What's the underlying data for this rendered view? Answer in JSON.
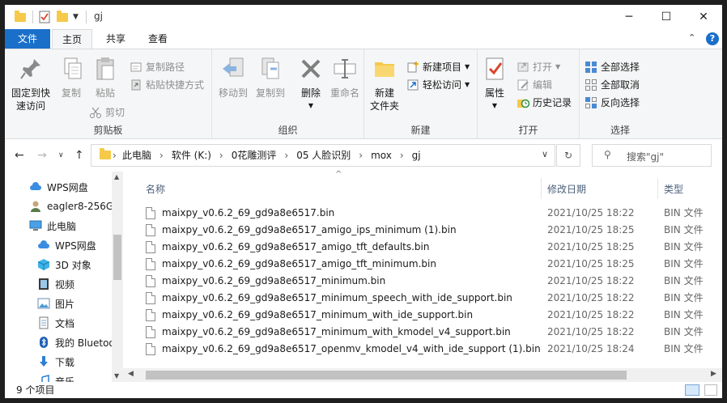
{
  "window": {
    "title": "gj",
    "minimize_glyph": "─",
    "maximize_glyph": "☐",
    "close_glyph": "✕"
  },
  "ribbon_tabs": [
    "文件",
    "主页",
    "共享",
    "查看"
  ],
  "ribbon": {
    "clipboard": {
      "pin": "固定到快\n速访问",
      "copy": "复制",
      "paste": "粘贴",
      "copy_path": "复制路径",
      "paste_shortcut": "粘贴快捷方式",
      "cut": "剪切",
      "label": "剪贴板"
    },
    "organize": {
      "move_to": "移动到",
      "copy_to": "复制到",
      "delete": "删除",
      "rename": "重命名",
      "label": "组织"
    },
    "new": {
      "new_folder": "新建\n文件夹",
      "new_item": "新建项目",
      "easy_access": "轻松访问",
      "label": "新建"
    },
    "open": {
      "properties": "属性",
      "open": "打开",
      "edit": "编辑",
      "history": "历史记录",
      "label": "打开"
    },
    "select": {
      "select_all": "全部选择",
      "select_none": "全部取消",
      "invert": "反向选择",
      "label": "选择"
    }
  },
  "address": {
    "crumbs": [
      "此电脑",
      "软件 (K:)",
      "0花雕测评",
      "05 人脸识别",
      "mox",
      "gj"
    ],
    "search_placeholder": "搜索\"gj\""
  },
  "nav_pane": [
    {
      "label": "WPS网盘",
      "icon": "cloud-icon",
      "indent": 1
    },
    {
      "label": "eagler8-256G",
      "icon": "user-icon",
      "indent": 1
    },
    {
      "label": "此电脑",
      "icon": "computer-icon",
      "indent": 0
    },
    {
      "label": "WPS网盘",
      "icon": "cloud-icon",
      "indent": 2
    },
    {
      "label": "3D 对象",
      "icon": "cube-icon",
      "indent": 2
    },
    {
      "label": "视频",
      "icon": "video-icon",
      "indent": 2
    },
    {
      "label": "图片",
      "icon": "picture-icon",
      "indent": 2
    },
    {
      "label": "文档",
      "icon": "document-icon",
      "indent": 2
    },
    {
      "label": "我的 Bluetooth",
      "icon": "bluetooth-icon",
      "indent": 2
    },
    {
      "label": "下载",
      "icon": "download-icon",
      "indent": 2
    },
    {
      "label": "音乐",
      "icon": "music-icon",
      "indent": 2
    }
  ],
  "columns": {
    "name": "名称",
    "date": "修改日期",
    "type": "类型"
  },
  "files": [
    {
      "name": "maixpy_v0.6.2_69_gd9a8e6517.bin",
      "date": "2021/10/25 18:22",
      "type": "BIN 文件"
    },
    {
      "name": "maixpy_v0.6.2_69_gd9a8e6517_amigo_ips_minimum (1).bin",
      "date": "2021/10/25 18:25",
      "type": "BIN 文件"
    },
    {
      "name": "maixpy_v0.6.2_69_gd9a8e6517_amigo_tft_defaults.bin",
      "date": "2021/10/25 18:25",
      "type": "BIN 文件"
    },
    {
      "name": "maixpy_v0.6.2_69_gd9a8e6517_amigo_tft_minimum.bin",
      "date": "2021/10/25 18:25",
      "type": "BIN 文件"
    },
    {
      "name": "maixpy_v0.6.2_69_gd9a8e6517_minimum.bin",
      "date": "2021/10/25 18:22",
      "type": "BIN 文件"
    },
    {
      "name": "maixpy_v0.6.2_69_gd9a8e6517_minimum_speech_with_ide_support.bin",
      "date": "2021/10/25 18:22",
      "type": "BIN 文件"
    },
    {
      "name": "maixpy_v0.6.2_69_gd9a8e6517_minimum_with_ide_support.bin",
      "date": "2021/10/25 18:22",
      "type": "BIN 文件"
    },
    {
      "name": "maixpy_v0.6.2_69_gd9a8e6517_minimum_with_kmodel_v4_support.bin",
      "date": "2021/10/25 18:22",
      "type": "BIN 文件"
    },
    {
      "name": "maixpy_v0.6.2_69_gd9a8e6517_openmv_kmodel_v4_with_ide_support (1).bin",
      "date": "2021/10/25 18:24",
      "type": "BIN 文件"
    }
  ],
  "status": {
    "item_count": "9 个项目"
  },
  "colors": {
    "accent": "#1a6fc9",
    "folder": "#f6c94a",
    "header_text": "#4c607a"
  }
}
